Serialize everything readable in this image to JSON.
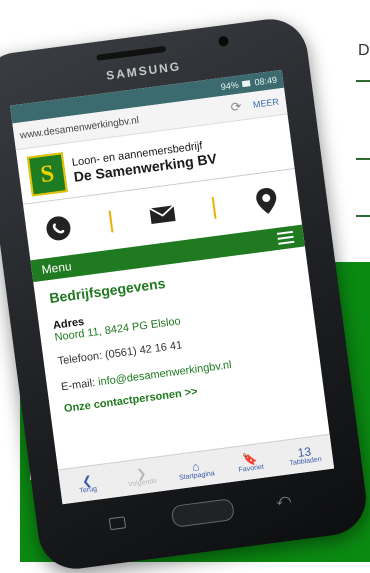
{
  "page": {
    "corner_letter": "D"
  },
  "phone": {
    "brand": "SAMSUNG",
    "status_bar": {
      "battery": "94%",
      "time": "08:49"
    },
    "browser": {
      "url": "www.desamenwerkingbv.nl",
      "more_label": "MEER"
    }
  },
  "site": {
    "subtitle": "Loon- en aannemersbedrijf",
    "title": "De Samenwerking BV",
    "menu_label": "Menu",
    "section_title": "Bedrijfsgegevens",
    "address_label": "Adres",
    "address_value": "Noord 11, 8424 PG Elsloo",
    "telephone": "Telefoon: (0561) 42 16 41",
    "email_prefix": "E-mail: ",
    "email": "info@desamenwerkingbv.nl",
    "contacts_link": "Onze contactpersonen >>",
    "icons": [
      "phone-icon",
      "mail-icon",
      "location-pin-icon"
    ]
  },
  "bottom_nav": [
    {
      "label": "Terug",
      "glyph": "❮"
    },
    {
      "label": "Volgende",
      "glyph": "❯"
    },
    {
      "label": "Startpagina",
      "glyph": "⌂"
    },
    {
      "label": "Favoriet",
      "glyph": "🔖"
    },
    {
      "label": "Tabbladen",
      "glyph": "13"
    }
  ],
  "colors": {
    "brand_green": "#1f7a20",
    "background_green": "#0b8a12",
    "accent_yellow": "#e8b400"
  }
}
